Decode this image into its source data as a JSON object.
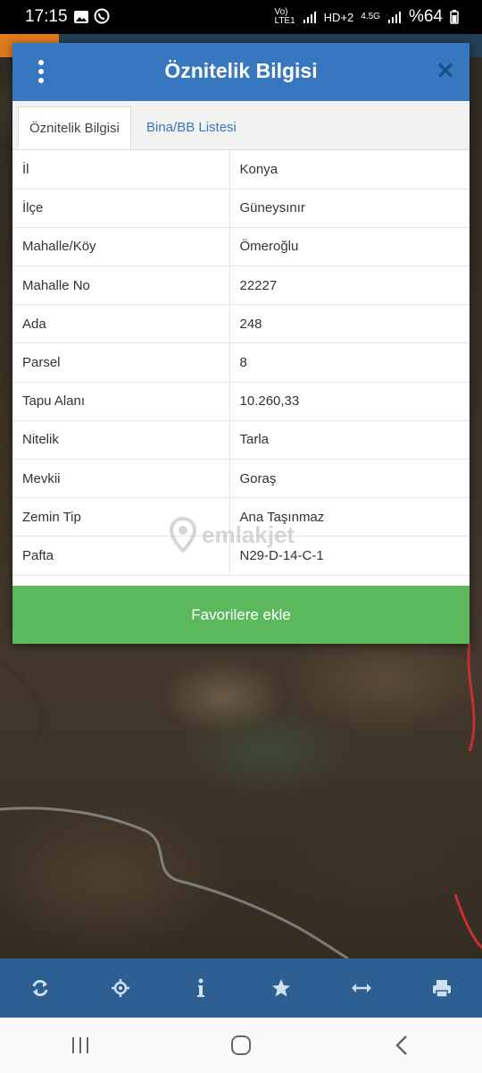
{
  "status_bar": {
    "time": "17:15",
    "network_1": "Vo)\nLTE1",
    "network_2": "4.5G",
    "battery": "%64"
  },
  "dialog": {
    "title": "Öznitelik Bilgisi",
    "tabs": [
      {
        "label": "Öznitelik Bilgisi",
        "active": true
      },
      {
        "label": "Bina/BB Listesi",
        "active": false
      }
    ],
    "rows": [
      {
        "key": "İl",
        "value": "Konya"
      },
      {
        "key": "İlçe",
        "value": "Güneysınır"
      },
      {
        "key": "Mahalle/Köy",
        "value": "Ömeroğlu"
      },
      {
        "key": "Mahalle No",
        "value": "22227"
      },
      {
        "key": "Ada",
        "value": "248"
      },
      {
        "key": "Parsel",
        "value": "8"
      },
      {
        "key": "Tapu Alanı",
        "value": "10.260,33"
      },
      {
        "key": "Nitelik",
        "value": "Tarla"
      },
      {
        "key": "Mevkii",
        "value": "Goraş"
      },
      {
        "key": "Zemin Tip",
        "value": "Ana Taşınmaz"
      },
      {
        "key": "Pafta",
        "value": "N29-D-14-C-1"
      }
    ],
    "favorite_button": "Favorilere ekle"
  },
  "watermark": "emlakjet",
  "toolbar": {
    "icons": [
      "refresh-icon",
      "locate-icon",
      "info-icon",
      "star-icon",
      "measure-icon",
      "print-icon"
    ]
  },
  "colors": {
    "header": "#3777c0",
    "toolbar": "#2d5f92",
    "favorite": "#5cb85c",
    "tab_link": "#3777c0"
  }
}
